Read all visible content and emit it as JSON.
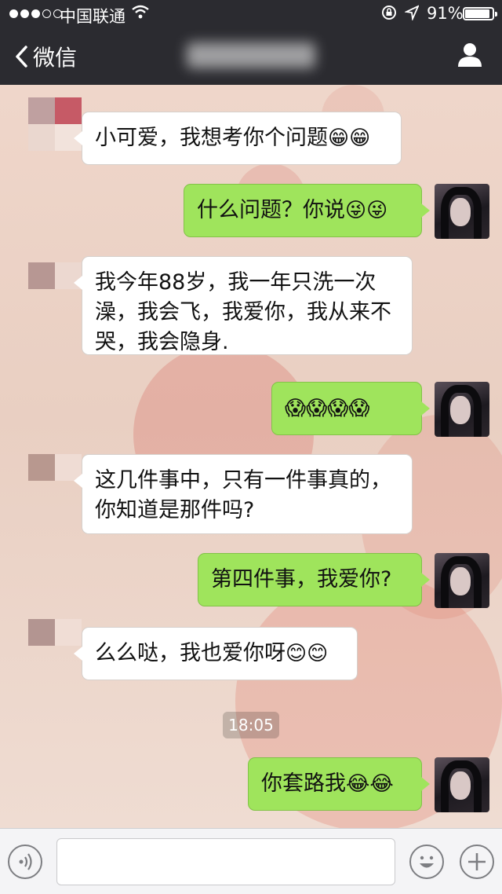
{
  "status_bar": {
    "carrier": "中国联通",
    "battery_percent": "91%",
    "battery_level": 0.91,
    "signal_bars_filled": 3,
    "signal_bars_total": 5
  },
  "nav": {
    "back_label": "微信",
    "back_icon": "chevron-left-icon",
    "profile_icon": "person-icon"
  },
  "messages": [
    {
      "side": "left",
      "text": "小可爱，我想考你个问题",
      "emoji": "😁😁"
    },
    {
      "side": "right",
      "text": "什么问题？你说",
      "emoji": "😜😜"
    },
    {
      "side": "left",
      "text": "我今年88岁，我一年只洗一次澡，我会飞，我爱你，我从来不哭，我会隐身.",
      "emoji": ""
    },
    {
      "side": "right",
      "text": "",
      "emoji": "😱😱😱😱"
    },
    {
      "side": "left",
      "text": "这几件事中，只有一件事真的，你知道是那件吗?",
      "emoji": ""
    },
    {
      "side": "right",
      "text": "第四件事，我爱你?",
      "emoji": ""
    },
    {
      "side": "left",
      "text": "么么哒，我也爱你呀",
      "emoji": "😊😊"
    },
    {
      "side": "right",
      "text": "你套路我",
      "emoji": "😂😂"
    }
  ],
  "timestamp": "18:05",
  "input_bar": {
    "voice_icon": "voice-icon",
    "emoji_icon": "smiley-icon",
    "plus_icon": "plus-icon",
    "value": ""
  },
  "colors": {
    "nav_bg": "#2b2b30",
    "sent_bubble": "#9fe45c",
    "received_bubble": "#ffffff"
  }
}
